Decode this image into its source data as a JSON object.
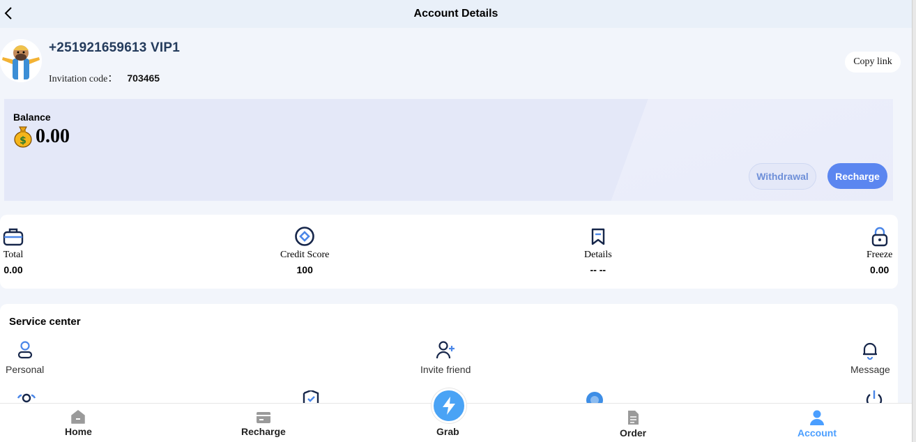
{
  "header": {
    "title": "Account Details"
  },
  "profile": {
    "phone": "+251921659613 VIP1",
    "invite_label": "Invitation code：",
    "invite_code": "703465",
    "copy_label": "Copy link"
  },
  "balance": {
    "label": "Balance",
    "value": "0.00",
    "withdraw_label": "Withdrawal",
    "recharge_label": "Recharge"
  },
  "stats": [
    {
      "label": "Total",
      "value": "0.00",
      "icon": "briefcase-icon"
    },
    {
      "label": "Credit Score",
      "value": "100",
      "icon": "credit-score-icon"
    },
    {
      "label": "Details",
      "value": "-- --",
      "icon": "bookmark-icon"
    },
    {
      "label": "Freeze",
      "value": "0.00",
      "icon": "lock-icon"
    }
  ],
  "service": {
    "title": "Service center",
    "items": [
      {
        "label": "Personal",
        "icon": "person-icon"
      },
      {
        "label": "Invite friend",
        "icon": "add-user-icon"
      },
      {
        "label": "Message",
        "icon": "bell-icon"
      }
    ]
  },
  "tabbar": {
    "items": [
      {
        "label": "Home",
        "icon": "home-icon"
      },
      {
        "label": "Recharge",
        "icon": "wallet-icon"
      },
      {
        "label": "Grab",
        "icon": "lightning-icon"
      },
      {
        "label": "Order",
        "icon": "document-icon"
      },
      {
        "label": "Account",
        "icon": "user-icon",
        "active": true
      }
    ]
  },
  "colors": {
    "accent": "#5b86f0",
    "active_tab": "#4a9eff",
    "grab": "#4aa3f5"
  }
}
